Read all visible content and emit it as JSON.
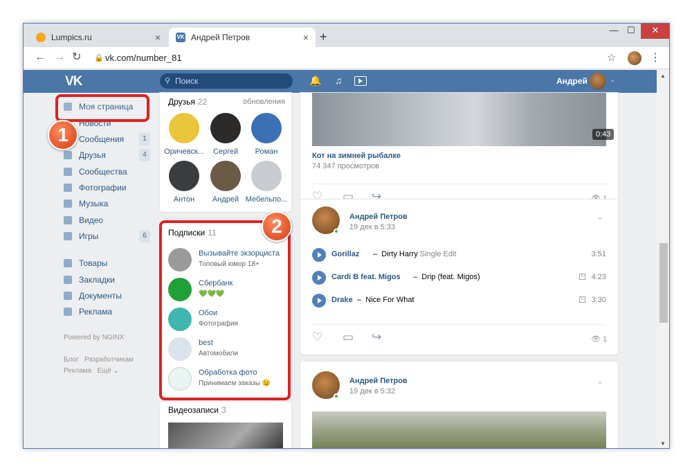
{
  "browser": {
    "tabs": [
      {
        "title": "Lumpics.ru"
      },
      {
        "title": "Андрей Петров"
      }
    ],
    "tab_close": "×",
    "new_tab": "+",
    "url": "vk.com/number_81"
  },
  "vk": {
    "logo": "VK",
    "search_placeholder": "Поиск",
    "user_name": "Андрей"
  },
  "nav": {
    "items": [
      {
        "label": "Моя страница",
        "count": ""
      },
      {
        "label": "Новости",
        "count": ""
      },
      {
        "label": "Сообщения",
        "count": "1"
      },
      {
        "label": "Друзья",
        "count": "4"
      },
      {
        "label": "Сообщества",
        "count": ""
      },
      {
        "label": "Фотографии",
        "count": ""
      },
      {
        "label": "Музыка",
        "count": ""
      },
      {
        "label": "Видео",
        "count": ""
      },
      {
        "label": "Игры",
        "count": "6"
      },
      {
        "label": "Товары",
        "count": ""
      },
      {
        "label": "Закладки",
        "count": ""
      },
      {
        "label": "Документы",
        "count": ""
      },
      {
        "label": "Реклама",
        "count": ""
      }
    ],
    "powered_by": "Powered by NGINX",
    "footer_links": [
      "Блог",
      "Разработчикам",
      "Реклама",
      "Ещё ⌄"
    ]
  },
  "badges": [
    "1",
    "2"
  ],
  "friends": {
    "title": "Друзья",
    "count": "22",
    "updates_link": "обновления",
    "items": [
      {
        "name": "Оричевск...",
        "color": "#e8c53a"
      },
      {
        "name": "Сергей",
        "color": "#2d2a2a"
      },
      {
        "name": "Роман",
        "color": "#3c6fb5"
      },
      {
        "name": "Антон",
        "color": "#3a3d40"
      },
      {
        "name": "Андрей",
        "color": "#6b5a45"
      },
      {
        "name": "Мебельпо...",
        "color": "#c8ccd0"
      }
    ]
  },
  "subscriptions": {
    "title": "Подписки",
    "count": "11",
    "items": [
      {
        "name": "Вызывайте экзорциста",
        "desc": "Топовый юмор 18+",
        "color": "#9a9a9a"
      },
      {
        "name": "Сбербанк",
        "desc": "💚💚💚",
        "color": "#21a038"
      },
      {
        "name": "Обои",
        "desc": "Фотография",
        "color": "#3fb6b0"
      },
      {
        "name": "best",
        "desc": "Автомобили",
        "color": "#dbe3ec"
      },
      {
        "name": "Обработка фото",
        "desc": "Принимаем заказы 😉",
        "color": "#e9f3f1"
      }
    ]
  },
  "videos": {
    "title": "Видеозаписи",
    "count": "3"
  },
  "feed": {
    "video_post": {
      "duration": "0:43",
      "title": "Кот на зимней рыбалке",
      "views_text": "74 347 просмотров",
      "views": "1"
    },
    "music_post": {
      "author": "Андрей Петров",
      "date": "19 дек в 5:33",
      "tracks": [
        {
          "artist": "Gorillaz",
          "title": "Dirty Harry",
          "extra": "Single Edit",
          "duration": "3:51",
          "explicit": ""
        },
        {
          "artist": "Cardi B feat. Migos",
          "title": "Drip (feat. Migos)",
          "extra": "",
          "duration": "4:23",
          "explicit": "E"
        },
        {
          "artist": "Drake",
          "title": "Nice For What",
          "extra": "",
          "duration": "3:30",
          "explicit": "E"
        }
      ],
      "dash": "–",
      "views": "1"
    },
    "photo_post": {
      "author": "Андрей Петров",
      "date": "19 дек в 5:32"
    }
  },
  "colors": {
    "vk_blue": "#4a76a8",
    "link": "#2a5885",
    "highlight": "#e02020",
    "badge": "#e8501f"
  }
}
